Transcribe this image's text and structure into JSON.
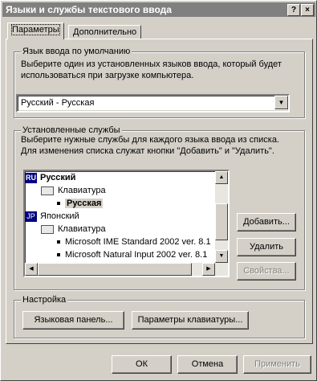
{
  "window": {
    "title": "Языки и службы текстового ввода",
    "help_label": "?",
    "close_label": "×"
  },
  "tabs": [
    {
      "label": "Параметры"
    },
    {
      "label": "Дополнительно"
    }
  ],
  "default_lang": {
    "legend": "Язык ввода по умолчанию",
    "description_line1": "Выберите один из установленных языков ввода, который будет",
    "description_line2": "использоваться при загрузке компьютера.",
    "selected": "Русский - Русская"
  },
  "services": {
    "legend": "Установленные службы",
    "description_line1": "Выберите нужные службы для каждого языка ввода из списка.",
    "description_line2": "Для изменения списка служат кнопки \"Добавить\" и \"Удалить\".",
    "tree": [
      {
        "badge": "RU",
        "label": "Русский"
      },
      {
        "label": "Клавиатура"
      },
      {
        "label": "Русская"
      },
      {
        "badge": "JP",
        "label": "Японский"
      },
      {
        "label": "Клавиатура"
      },
      {
        "label": "Microsoft IME Standard 2002 ver. 8.1"
      },
      {
        "label": "Microsoft Natural Input 2002 ver. 8.1"
      }
    ],
    "add_label": "Добавить...",
    "remove_label": "Удалить",
    "properties_label": "Свойства..."
  },
  "settings": {
    "legend": "Настройка",
    "language_bar_label": "Языковая панель...",
    "keyboard_settings_label": "Параметры клавиатуры..."
  },
  "footer": {
    "ok_label": "ОК",
    "cancel_label": "Отмена",
    "apply_label": "Применить"
  }
}
